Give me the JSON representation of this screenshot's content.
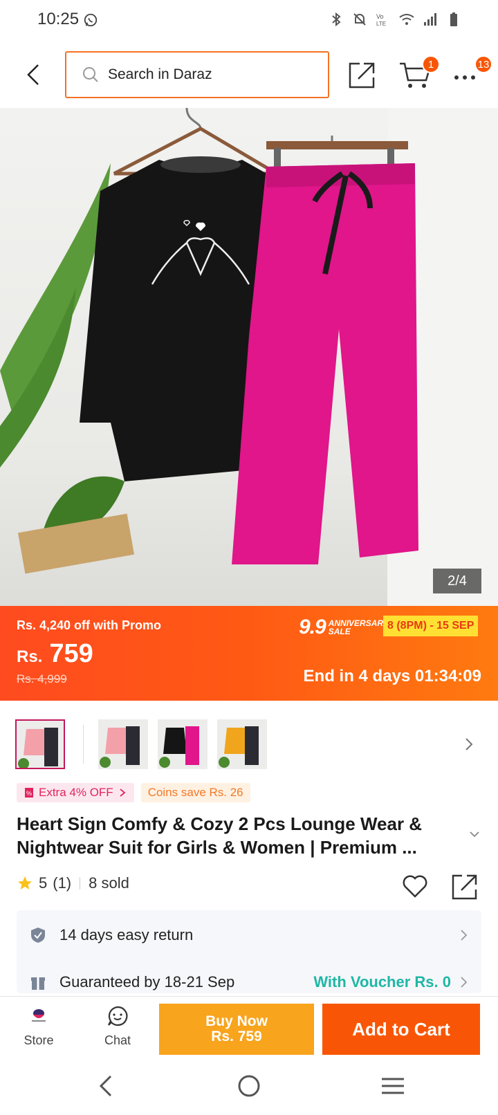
{
  "status_bar": {
    "time": "10:25"
  },
  "header": {
    "search_placeholder": "Search in Daraz",
    "cart_count": "1",
    "more_count": "13"
  },
  "gallery": {
    "counter": "2/4"
  },
  "promo": {
    "off_text": "Rs. 4,240 off with Promo",
    "currency": "Rs.",
    "price": "759",
    "original_price": "Rs. 4,999",
    "sale_number": "9.9",
    "sale_word_line1": "ANNIVERSARY",
    "sale_word_line2": "SALE",
    "sale_dates": "8 (8PM) - 15 SEP",
    "countdown": "End in 4 days 01:34:09"
  },
  "tags": {
    "extra": "Extra 4% OFF",
    "coins": "Coins save Rs. 26"
  },
  "product": {
    "title": "Heart Sign Comfy & Cozy 2 Pcs Lounge Wear & Nightwear Suit for Girls & Women | Premium ...",
    "rating": "5",
    "review_count": "(1)",
    "sold": "8 sold"
  },
  "service": {
    "return_text": "14 days easy return",
    "delivery_text": "Guaranteed by 18-21 Sep",
    "voucher_text": "With Voucher Rs. 0"
  },
  "actions": {
    "store_label": "Store",
    "chat_label": "Chat",
    "buy_now_line1": "Buy Now",
    "buy_now_line2": "Rs. 759",
    "add_to_cart": "Add to Cart"
  },
  "colors": {
    "accent": "#f85606",
    "buy_now": "#f8a41d",
    "voucher": "#1fb7a6"
  }
}
